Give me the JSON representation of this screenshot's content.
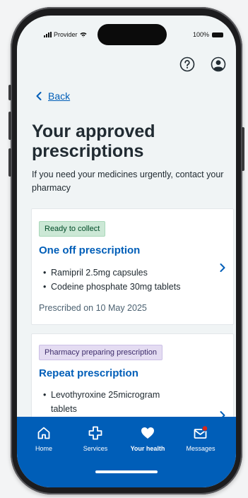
{
  "status_bar": {
    "carrier": "Provider",
    "battery": "100%"
  },
  "header": {
    "help_icon": "help-circle-icon",
    "account_icon": "account-icon"
  },
  "back_link": {
    "label": "Back"
  },
  "page": {
    "title": "Your approved prescriptions",
    "subtitle": "If you need your medicines urgently, contact your pharmacy"
  },
  "cards": [
    {
      "status": "Ready to collect",
      "title": "One off prescription",
      "medicines": [
        "Ramipril 2.5mg capsules",
        "Codeine phosphate 30mg tablets"
      ],
      "prescribed": "Prescribed on 10 May 2025"
    },
    {
      "status": "Pharmacy preparing prescription",
      "title": "Repeat prescription",
      "medicines": [
        "Levothyroxine 25microgram tablets"
      ]
    }
  ],
  "bottom_nav": {
    "items": [
      {
        "label": "Home",
        "icon": "home-icon"
      },
      {
        "label": "Services",
        "icon": "services-cross-icon"
      },
      {
        "label": "Your health",
        "icon": "heart-icon",
        "active": true
      },
      {
        "label": "Messages",
        "icon": "envelope-icon",
        "badge": true
      }
    ]
  },
  "colors": {
    "brand_blue": "#005eb8",
    "text": "#212b32",
    "ready_tag": "#cce8d6",
    "preparing_tag": "#e4dcf2",
    "badge": "#d5281b"
  }
}
